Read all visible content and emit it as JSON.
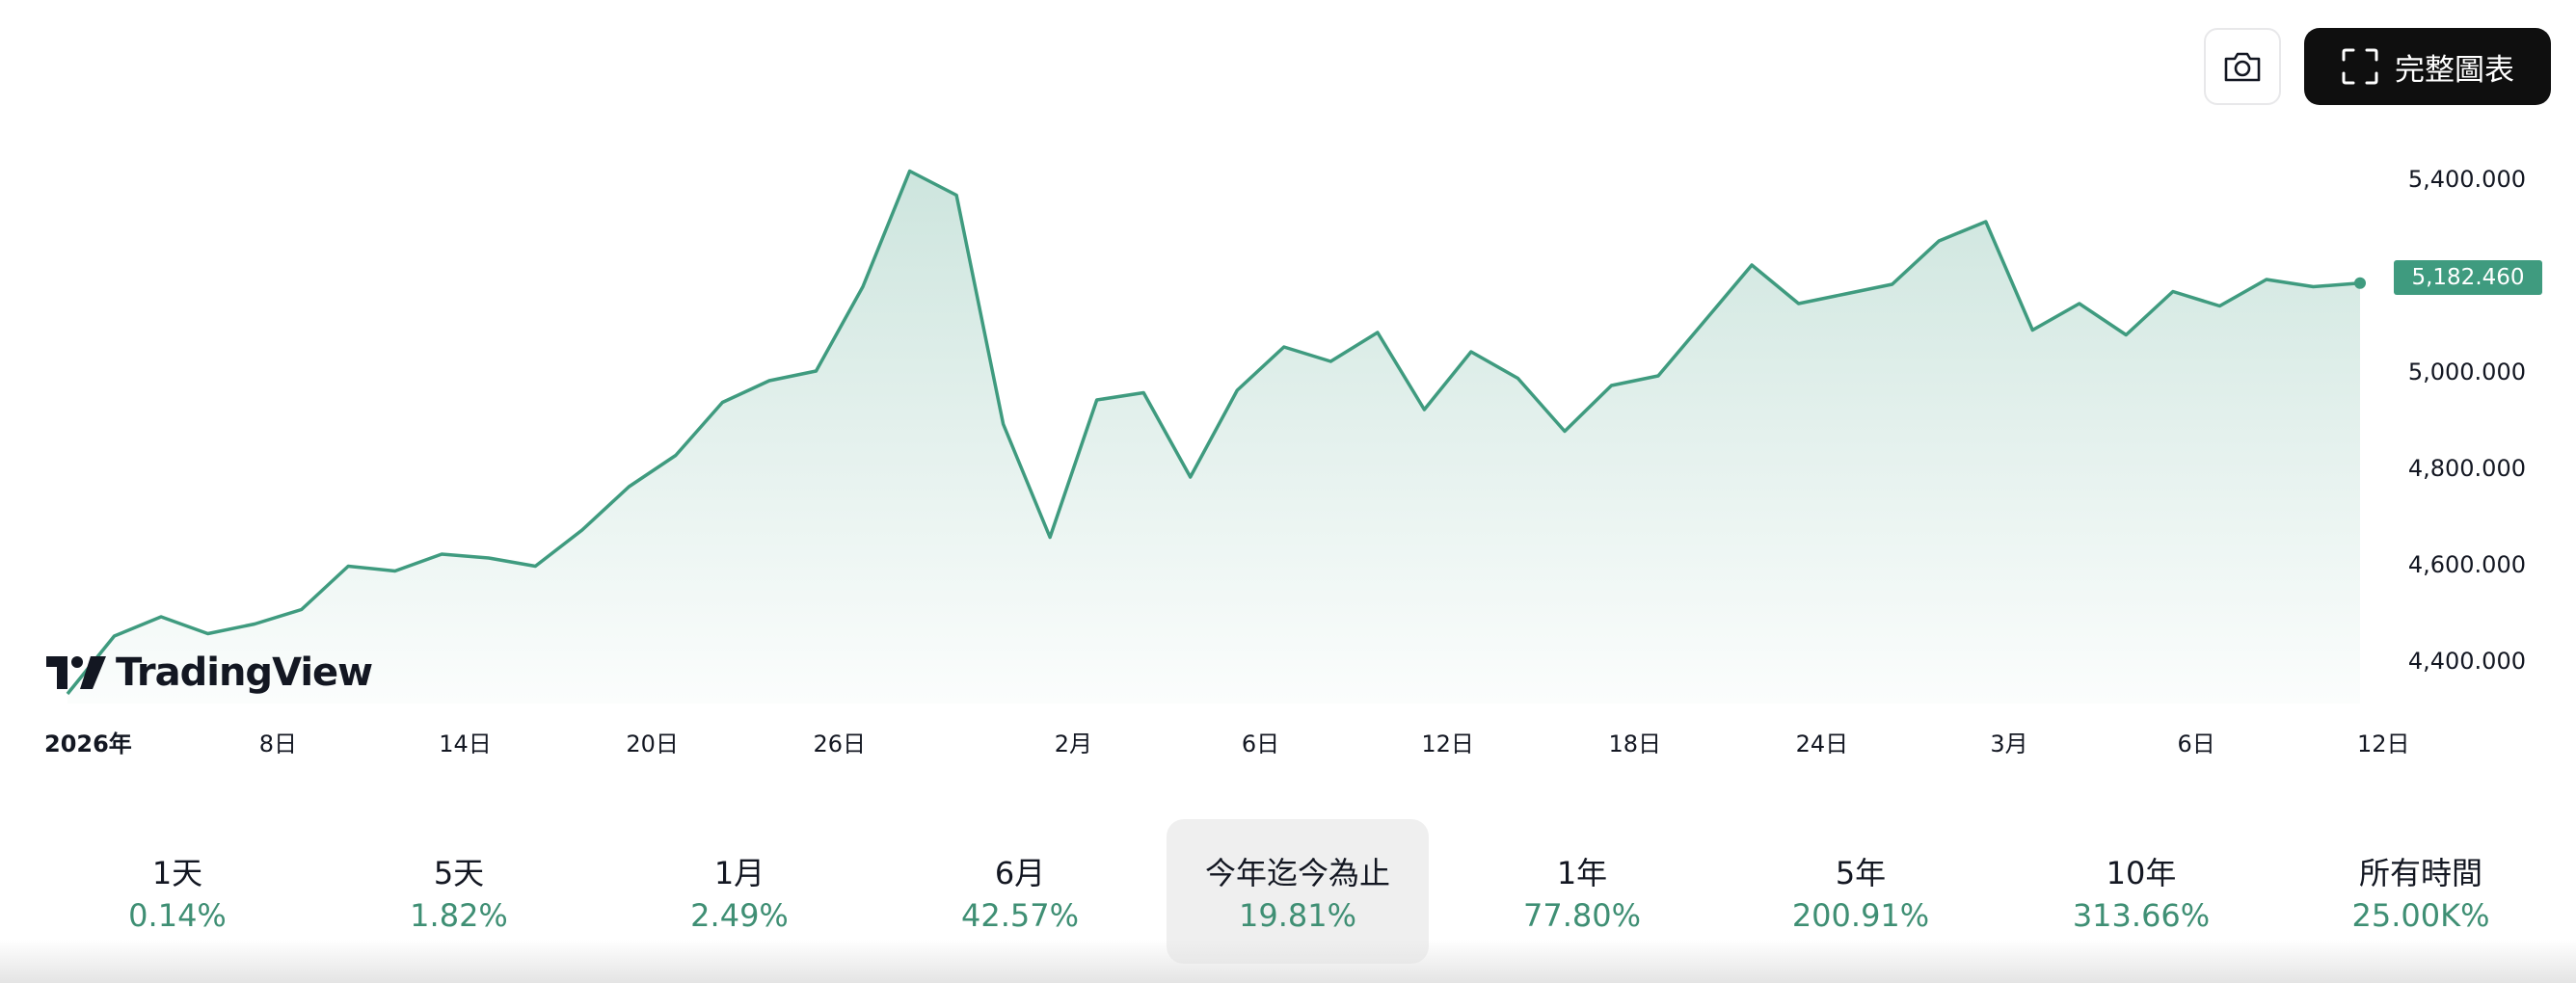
{
  "toolbar": {
    "snapshot_icon": "camera-icon",
    "fullchart_icon": "fullscreen-corners-icon",
    "fullchart_label": "完整圖表"
  },
  "branding": {
    "logo_text": "TradingView",
    "logo_icon": "tradingview-logo-icon"
  },
  "colors": {
    "line": "#3f9b7f",
    "fill_top": "#3f9b7f",
    "badge": "#3f9b7f",
    "positive_text": "#3f8f74"
  },
  "chart_data": {
    "type": "area",
    "y_ticks": [
      "4,400.000",
      "4,600.000",
      "4,800.000",
      "5,000.000",
      "5,200.000",
      "5,400.000"
    ],
    "y_tick_values": [
      4400,
      4600,
      4800,
      5000,
      5200,
      5400
    ],
    "ylim": [
      4310,
      5470
    ],
    "last_value_label": "5,182.460",
    "x_ticks": [
      {
        "label": "2026年",
        "index": 0,
        "bold": true
      },
      {
        "label": "8日",
        "index": 4.5
      },
      {
        "label": "14日",
        "index": 8.5
      },
      {
        "label": "20日",
        "index": 12.5
      },
      {
        "label": "26日",
        "index": 16.5
      },
      {
        "label": "2月",
        "index": 21.5
      },
      {
        "label": "6日",
        "index": 25.5
      },
      {
        "label": "12日",
        "index": 29.5
      },
      {
        "label": "18日",
        "index": 33.5
      },
      {
        "label": "24日",
        "index": 37.5
      },
      {
        "label": "3月",
        "index": 41.5
      },
      {
        "label": "6日",
        "index": 45.5
      },
      {
        "label": "12日",
        "index": 49.5
      }
    ],
    "values": [
      4330,
      4450,
      4490,
      4455,
      4475,
      4505,
      4595,
      4585,
      4620,
      4612,
      4595,
      4670,
      4760,
      4825,
      4935,
      4980,
      5000,
      5175,
      5415,
      5365,
      4890,
      4655,
      4940,
      4955,
      4780,
      4960,
      5050,
      5020,
      5080,
      4920,
      5040,
      4985,
      4875,
      4970,
      4990,
      5105,
      5220,
      5140,
      5160,
      5180,
      5270,
      5310,
      5085,
      5140,
      5075,
      5165,
      5135,
      5190,
      5175,
      5182.46
    ]
  },
  "tabs": [
    {
      "label": "1天",
      "change": "0.14%",
      "active": false
    },
    {
      "label": "5天",
      "change": "1.82%",
      "active": false
    },
    {
      "label": "1月",
      "change": "2.49%",
      "active": false
    },
    {
      "label": "6月",
      "change": "42.57%",
      "active": false
    },
    {
      "label": "今年迄今為止",
      "change": "19.81%",
      "active": true
    },
    {
      "label": "1年",
      "change": "77.80%",
      "active": false
    },
    {
      "label": "5年",
      "change": "200.91%",
      "active": false
    },
    {
      "label": "10年",
      "change": "313.66%",
      "active": false
    },
    {
      "label": "所有時間",
      "change": "25.00K%",
      "active": false
    }
  ]
}
